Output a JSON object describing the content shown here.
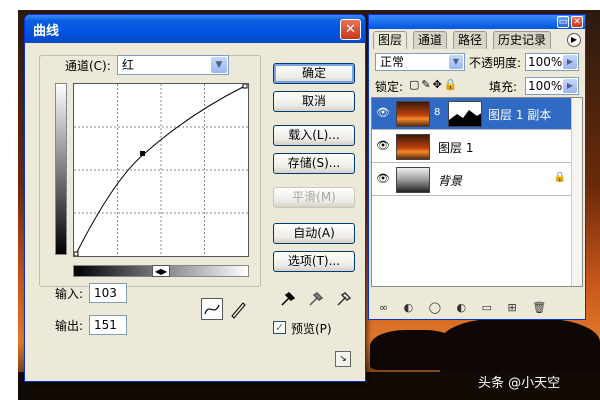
{
  "curves_dialog": {
    "title": "曲线",
    "close_symbol": "✕",
    "channel_label": "通道(C):",
    "channel_value": "红",
    "input_label": "输入:",
    "input_value": "103",
    "output_label": "输出:",
    "output_value": "151",
    "buttons": {
      "ok": "确定",
      "cancel": "取消",
      "load": "载入(L)...",
      "save": "存储(S)...",
      "smooth": "平滑(M)",
      "auto": "自动(A)",
      "options": "选项(T)..."
    },
    "preview_label": "预览(P)",
    "preview_checked": true
  },
  "layers_panel": {
    "tabs": [
      "图层",
      "通道",
      "路径",
      "历史记录"
    ],
    "blend_mode": "正常",
    "opacity_label": "不透明度:",
    "opacity_value": "100%",
    "lock_label": "锁定:",
    "fill_label": "填充:",
    "fill_value": "100%",
    "layers": [
      {
        "name": "图层 1 副本",
        "selected": true,
        "has_mask": true
      },
      {
        "name": "图层 1",
        "selected": false
      },
      {
        "name": "背景",
        "selected": false,
        "locked": true
      }
    ]
  },
  "watermark": "头条 @小天空",
  "icons": {
    "curve_tool": "curve-tool-icon",
    "pencil_tool": "pencil-icon",
    "eyedroppers": [
      "eyedropper-black-icon",
      "eyedropper-gray-icon",
      "eyedropper-white-icon"
    ],
    "eye": "eye-icon",
    "lock": "lock-icon"
  }
}
